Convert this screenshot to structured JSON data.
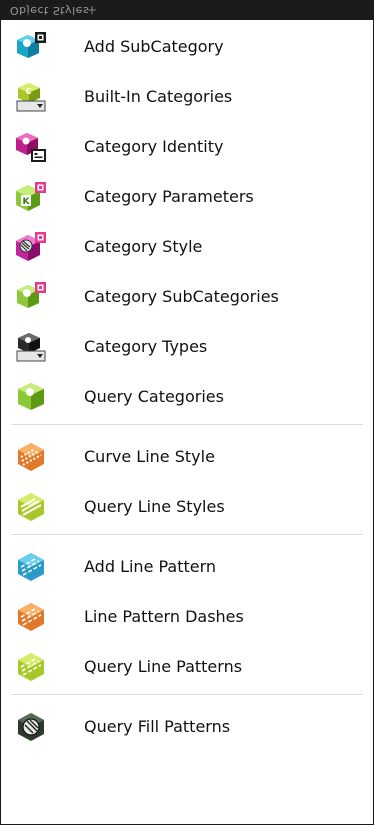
{
  "panel": {
    "title": "Object Styles"
  },
  "items": [
    {
      "label": "Add SubCategory",
      "icon": "category-add-icon",
      "color": "#1aa6c8"
    },
    {
      "label": "Built-In Categories",
      "icon": "builtin-categories-icon",
      "color": "#a8c82a"
    },
    {
      "label": "Category Identity",
      "icon": "category-identity-icon",
      "color": "#c0208a"
    },
    {
      "label": "Category Parameters",
      "icon": "category-parameters-icon",
      "color": "#8cc83a"
    },
    {
      "label": "Category Style",
      "icon": "category-style-icon",
      "color": "#c2249a"
    },
    {
      "label": "Category SubCategories",
      "icon": "category-subcategories-icon",
      "color": "#8cc83a"
    },
    {
      "label": "Category Types",
      "icon": "category-types-icon",
      "color": "#2a2a2a"
    },
    {
      "label": "Query Categories",
      "icon": "query-categories-icon",
      "color": "#8cc83a"
    },
    {
      "label": "Curve Line Style",
      "icon": "curve-line-style-icon",
      "color": "#e07a2a"
    },
    {
      "label": "Query Line Styles",
      "icon": "query-line-styles-icon",
      "color": "#a8c82a"
    },
    {
      "label": "Add Line Pattern",
      "icon": "add-line-pattern-icon",
      "color": "#2a9ac8"
    },
    {
      "label": "Line Pattern Dashes",
      "icon": "line-pattern-dashes-icon",
      "color": "#e07a2a"
    },
    {
      "label": "Query Line Patterns",
      "icon": "query-line-patterns-icon",
      "color": "#a8c82a"
    },
    {
      "label": "Query Fill Patterns",
      "icon": "query-fill-patterns-icon",
      "color": "#2e3a2e"
    }
  ]
}
